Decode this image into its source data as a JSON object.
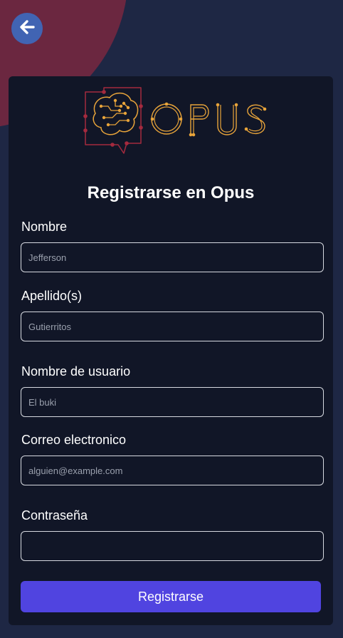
{
  "brand": {
    "logo_text": "OPUS"
  },
  "colors": {
    "background": "#1e2744",
    "accent_blob": "#6b2740",
    "card": "#111627",
    "back_button": "#4164b3",
    "primary_button": "#5044e0",
    "logo_gold": "#e8a43a",
    "logo_red": "#a42a3e"
  },
  "header": {
    "back_icon": "arrow-left-icon"
  },
  "form": {
    "title": "Registrarse en Opus",
    "fields": [
      {
        "label": "Nombre",
        "placeholder": "Jefferson"
      },
      {
        "label": "Apellido(s)",
        "placeholder": "Gutierritos"
      },
      {
        "label": "Nombre de usuario",
        "placeholder": "El buki"
      },
      {
        "label": "Correo electronico",
        "placeholder": "alguien@example.com"
      },
      {
        "label": "Contraseña",
        "placeholder": ""
      }
    ],
    "submit_label": "Registrarse"
  }
}
